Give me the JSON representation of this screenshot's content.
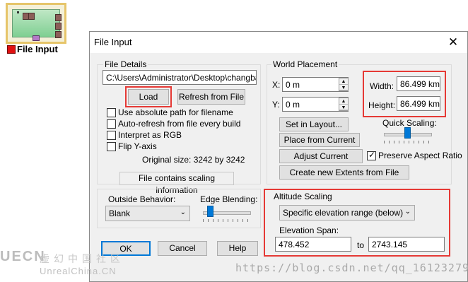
{
  "node": {
    "label": "File Input"
  },
  "dialog": {
    "title": "File Input",
    "close_glyph": "✕",
    "file_details": {
      "group_label": "File Details",
      "path": "C:\\Users\\Administrator\\Desktop\\changbaishan",
      "load_label": "Load",
      "refresh_label": "Refresh from File",
      "options": [
        {
          "label": "Use absolute path for filename",
          "checked": false
        },
        {
          "label": "Auto-refresh from file every build",
          "checked": false
        },
        {
          "label": "Interpret as RGB",
          "checked": false
        },
        {
          "label": "Flip Y-axis",
          "checked": false
        }
      ],
      "original_size": "Original size: 3242 by 3242",
      "scaling_info_label": "File contains scaling information"
    },
    "outside_behavior": {
      "label": "Outside Behavior:",
      "value": "Blank"
    },
    "edge_blending": {
      "label": "Edge Blending:",
      "level": 0.1
    },
    "buttons": {
      "ok": "OK",
      "cancel": "Cancel",
      "help": "Help"
    },
    "world_placement": {
      "group_label": "World Placement",
      "x_label": "X:",
      "x_value": "0 m",
      "y_label": "Y:",
      "y_value": "0 m",
      "width_label": "Width:",
      "width_value": "86.499 km",
      "height_label": "Height:",
      "height_value": "86.499 km",
      "set_in_layout": "Set in Layout...",
      "place_from_current": "Place from Current",
      "adjust_current_extents": "Adjust Current Extents",
      "quick_scaling_label": "Quick Scaling:",
      "quick_scaling_level": 0.5,
      "preserve_aspect_label": "Preserve Aspect Ratio",
      "preserve_aspect_checked": true,
      "create_new_extents": "Create new Extents from File"
    },
    "altitude_scaling": {
      "group_label": "Altitude Scaling",
      "mode": "Specific elevation range (below)",
      "span_label": "Elevation Span:",
      "span_from": "478.452",
      "span_to_label": "to",
      "span_to": "2743.145"
    }
  },
  "watermarks": {
    "left_logo": "UECN",
    "left_cn": "虚幻中国社区",
    "left_sub": "UnrealChina.CN",
    "right_url": "https://blog.csdn.net/qq_16123279"
  },
  "colors": {
    "highlight": "#e53935",
    "slider_accent": "#0078d7"
  }
}
